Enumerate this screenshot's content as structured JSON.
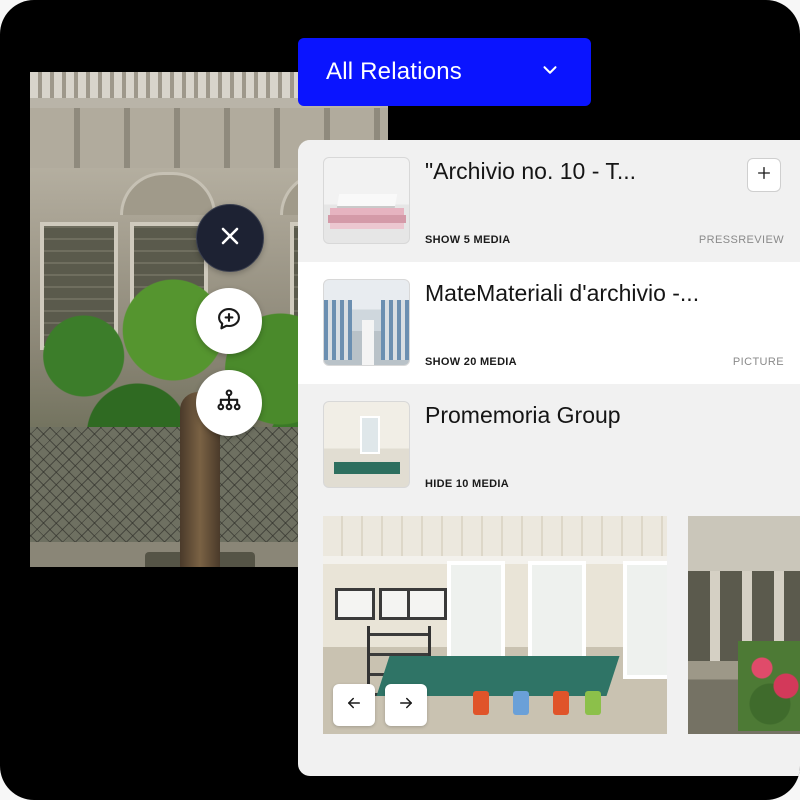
{
  "relations_filter": {
    "label": "All Relations"
  },
  "side_actions": [
    {
      "icon": "close-icon"
    },
    {
      "icon": "comment-add-icon"
    },
    {
      "icon": "hierarchy-icon"
    }
  ],
  "relations": [
    {
      "title": "\"Archivio no. 10 - T...",
      "media_toggle": "SHOW 5 MEDIA",
      "type": "PRESSREVIEW",
      "thumbnail_icon": "book-thumbnail"
    },
    {
      "title": "MateMateriali d'archivio -...",
      "media_toggle": "SHOW 20 MEDIA",
      "type": "PICTURE",
      "thumbnail_icon": "corridor-thumbnail"
    },
    {
      "title": "Promemoria Group",
      "media_toggle": "HIDE 10 MEDIA",
      "type": "",
      "thumbnail_icon": "office-thumbnail"
    }
  ],
  "colors": {
    "accent": "#0a14ff",
    "dark_button": "#1d2233",
    "panel_bg": "#f1f1f1"
  }
}
